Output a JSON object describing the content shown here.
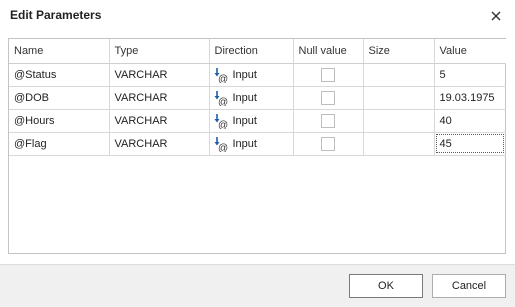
{
  "dialog": {
    "title": "Edit Parameters"
  },
  "grid": {
    "columns": [
      "Name",
      "Type",
      "Direction",
      "Null value",
      "Size",
      "Value"
    ],
    "rows": [
      {
        "name": "@Status",
        "type": "VARCHAR",
        "direction": "Input",
        "null_value": false,
        "size": "",
        "value": "5"
      },
      {
        "name": "@DOB",
        "type": "VARCHAR",
        "direction": "Input",
        "null_value": false,
        "size": "",
        "value": "19.03.1975"
      },
      {
        "name": "@Hours",
        "type": "VARCHAR",
        "direction": "Input",
        "null_value": false,
        "size": "",
        "value": "40"
      },
      {
        "name": "@Flag",
        "type": "VARCHAR",
        "direction": "Input",
        "null_value": false,
        "size": "",
        "value": "45"
      }
    ]
  },
  "buttons": {
    "ok_label": "OK",
    "cancel_label": "Cancel"
  },
  "colors": {
    "direction_arrow": "#1f5fa8",
    "border": "#c4c4c4",
    "footer_bg": "#f0f0f0"
  },
  "icons": {
    "close": "close-icon",
    "direction": "input-direction-icon"
  }
}
